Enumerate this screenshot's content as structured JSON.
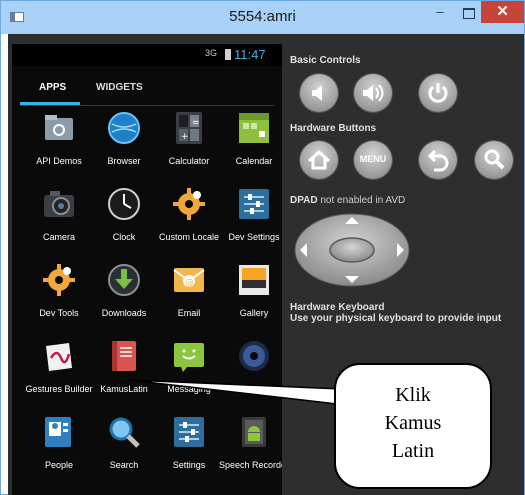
{
  "window": {
    "title": "5554:amri",
    "minimize_glyph": "–",
    "close_glyph": "✕"
  },
  "status": {
    "signal": "3G",
    "time": "11:47"
  },
  "tabs": [
    "APPS",
    "WIDGETS"
  ],
  "apps": [
    {
      "label": "API Demos",
      "icon": "folder-gear-icon"
    },
    {
      "label": "Browser",
      "icon": "globe-icon"
    },
    {
      "label": "Calculator",
      "icon": "calculator-icon"
    },
    {
      "label": "Calendar",
      "icon": "calendar-icon"
    },
    {
      "label": "Camera",
      "icon": "camera-icon"
    },
    {
      "label": "Clock",
      "icon": "clock-icon"
    },
    {
      "label": "Custom Locale",
      "icon": "gear-icon"
    },
    {
      "label": "Dev Settings",
      "icon": "sliders-icon"
    },
    {
      "label": "Dev Tools",
      "icon": "gear-icon"
    },
    {
      "label": "Downloads",
      "icon": "download-icon"
    },
    {
      "label": "Email",
      "icon": "email-icon"
    },
    {
      "label": "Gallery",
      "icon": "picture-icon"
    },
    {
      "label": "Gestures Builder",
      "icon": "gesture-icon"
    },
    {
      "label": "KamusLatin",
      "icon": "book-icon"
    },
    {
      "label": "Messaging",
      "icon": "message-icon"
    },
    {
      "label": "",
      "icon": "music-icon"
    },
    {
      "label": "People",
      "icon": "contacts-icon"
    },
    {
      "label": "Search",
      "icon": "magnifier-icon"
    },
    {
      "label": "Settings",
      "icon": "sliders-icon"
    },
    {
      "label": "Speech Recorder",
      "icon": "android-icon"
    }
  ],
  "controls": {
    "basic_title": "Basic Controls",
    "hardware_title": "Hardware Buttons",
    "menu_label": "MENU",
    "dpad_title": "DPAD",
    "dpad_note": " not enabled in AVD",
    "keyboard_title": "Hardware Keyboard",
    "keyboard_note": "Use your physical keyboard to provide input"
  },
  "callout": {
    "lines": [
      "Klik",
      "Kamus",
      "Latin"
    ]
  },
  "colors": {
    "accent": "#33b5e5",
    "titlebar": "#a8d1f7",
    "close": "#c7443b",
    "emulator_bg": "#2e2e2e"
  }
}
